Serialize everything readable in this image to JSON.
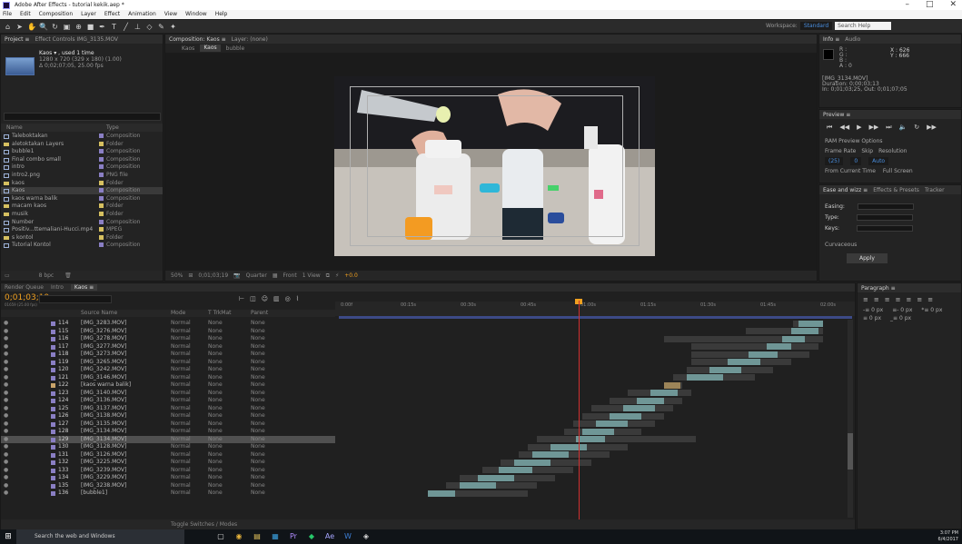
{
  "window": {
    "title": "Adobe After Effects - tutorial kekik.aep *",
    "controls": [
      "–",
      "□",
      "✕"
    ]
  },
  "menu": [
    "File",
    "Edit",
    "Composition",
    "Layer",
    "Effect",
    "Animation",
    "View",
    "Window",
    "Help"
  ],
  "workspace": {
    "label": "Workspace:",
    "value": "Standard",
    "search_placeholder": "Search Help"
  },
  "project": {
    "tabs": [
      "Project ≡",
      "Effect Controls IMG_3135.MOV"
    ],
    "selected_name": "Kaos ▾ , used 1 time",
    "selected_info_1": "1280 x 720 (329 x 180) (1.00)",
    "selected_info_2": "Δ 0;02;07;05, 25.00 fps",
    "search_placeholder": "",
    "col_name": "Name",
    "col_type": "Type",
    "items": [
      {
        "name": "Taleboktakan",
        "type": "Composition",
        "icon": "comp",
        "label": "#8a7fc4"
      },
      {
        "name": "aletoktakan Layers",
        "type": "Folder",
        "icon": "folder",
        "label": "#d6c060"
      },
      {
        "name": "bubble1",
        "type": "Composition",
        "icon": "comp",
        "label": "#8a7fc4"
      },
      {
        "name": "Final combo small",
        "type": "Composition",
        "icon": "comp",
        "label": "#8a7fc4"
      },
      {
        "name": "intro",
        "type": "Composition",
        "icon": "comp",
        "label": "#8a7fc4"
      },
      {
        "name": "intro2.png",
        "type": "PNG file",
        "icon": "image",
        "label": "#8a7fc4"
      },
      {
        "name": "kaos",
        "type": "Folder",
        "icon": "folder",
        "label": "#d6c060"
      },
      {
        "name": "Kaos",
        "type": "Composition",
        "icon": "comp",
        "label": "#8a7fc4",
        "selected": true
      },
      {
        "name": "kaos warna balik",
        "type": "Composition",
        "icon": "comp",
        "label": "#8a7fc4"
      },
      {
        "name": "macam kaos",
        "type": "Folder",
        "icon": "folder",
        "label": "#d6c060"
      },
      {
        "name": "musik",
        "type": "Folder",
        "icon": "folder",
        "label": "#d6c060"
      },
      {
        "name": "Number",
        "type": "Composition",
        "icon": "comp",
        "label": "#8a7fc4"
      },
      {
        "name": "Positiv...ttemaliani-Hucci.mp4",
        "type": "MPEG",
        "icon": "video",
        "label": "#d6c060"
      },
      {
        "name": "s kontol",
        "type": "Folder",
        "icon": "folder",
        "label": "#d6c060"
      },
      {
        "name": "Tutorial Kontol",
        "type": "Composition",
        "icon": "comp",
        "label": "#8a7fc4"
      }
    ],
    "footer": "8 bpc"
  },
  "comp_viewer": {
    "tab": "Composition: Kaos ≡",
    "tab2": "Layer: (none)",
    "flow_label": "Kaos",
    "crumb": "Kaos",
    "crumb2": "bubble",
    "zoom": "50%",
    "timecode": "0;01;03;19",
    "resolution": "Quarter",
    "camera": "Front",
    "views": "1 View",
    "plus": "+0.0"
  },
  "info_panel": {
    "tabs": [
      "Info ≡",
      "Audio"
    ],
    "rgb": [
      "R :",
      "G :",
      "B :",
      "A : 0"
    ],
    "x": "X : 626",
    "y": "Y : 666",
    "clip_name": "[IMG_3134.MOV]",
    "duration": "Duration: 0;00;03;13",
    "inout": "In: 0;01;03;25, Out: 0;01;07;05"
  },
  "preview_panel": {
    "title": "Preview ≡",
    "ram": "RAM Preview Options",
    "frame_rate": "Frame Rate",
    "skip": "Skip",
    "resolution": "Resolution",
    "fr_value": "(25)",
    "skip_value": "0",
    "res_value": "Auto",
    "from_current": "From Current Time",
    "full_screen": "Full Screen"
  },
  "tracker_panel": {
    "tabs": [
      "Ease and wizz ≡",
      "Effects & Presets",
      "Tracker"
    ],
    "easing_label": "Easing:",
    "type_label": "Type:",
    "keys_label": "Keys:",
    "curvaceous": "Curvaceous",
    "apply": "Apply"
  },
  "timeline": {
    "tabs": [
      "Render Queue",
      "Intro",
      "Kaos ≡"
    ],
    "timecode": "0;01;03;19",
    "fps": "01659 (25.00 fps)",
    "col_source": "Source Name",
    "col_mode": "Mode",
    "col_trk": "T TrkMat",
    "col_parent": "Parent",
    "footer_toggle": "Toggle Switches / Modes",
    "ruler": [
      "0:00f",
      "00:15s",
      "00:30s",
      "00:45s",
      "01:00s",
      "01:15s",
      "01:30s",
      "01:45s",
      "02:00s"
    ],
    "layers": [
      {
        "num": "114",
        "name": "[IMG_3283.MOV]",
        "mode": "Normal",
        "trk": "None",
        "parent": "None",
        "bar_start": 872,
        "bar_end": 905,
        "in_start": 878,
        "in_end": 905
      },
      {
        "num": "115",
        "name": "[IMG_3276.MOV]",
        "mode": "Normal",
        "trk": "None",
        "parent": "None",
        "bar_start": 820,
        "bar_end": 905,
        "in_start": 870,
        "in_end": 900
      },
      {
        "num": "116",
        "name": "[IMG_3278.MOV]",
        "mode": "Normal",
        "trk": "None",
        "parent": "None",
        "bar_start": 730,
        "bar_end": 905,
        "in_start": 860,
        "in_end": 885
      },
      {
        "num": "117",
        "name": "[IMG_3277.MOV]",
        "mode": "Normal",
        "trk": "None",
        "parent": "None",
        "bar_start": 760,
        "bar_end": 900,
        "in_start": 843,
        "in_end": 870
      },
      {
        "num": "118",
        "name": "[IMG_3273.MOV]",
        "mode": "Normal",
        "trk": "None",
        "parent": "None",
        "bar_start": 760,
        "bar_end": 890,
        "in_start": 823,
        "in_end": 855
      },
      {
        "num": "119",
        "name": "[IMG_3265.MOV]",
        "mode": "Normal",
        "trk": "None",
        "parent": "None",
        "bar_start": 760,
        "bar_end": 870,
        "in_start": 800,
        "in_end": 836
      },
      {
        "num": "120",
        "name": "[IMG_3242.MOV]",
        "mode": "Normal",
        "trk": "None",
        "parent": "None",
        "bar_start": 755,
        "bar_end": 850,
        "in_start": 780,
        "in_end": 815
      },
      {
        "num": "121",
        "name": "[IMG_3146.MOV]",
        "mode": "Normal",
        "trk": "None",
        "parent": "None",
        "bar_start": 740,
        "bar_end": 830,
        "in_start": 755,
        "in_end": 795
      },
      {
        "num": "122",
        "name": "[kaos warna balik]",
        "mode": "Normal",
        "trk": "None",
        "parent": "None",
        "bar_start": 730,
        "bar_end": 750,
        "in_start": 730,
        "in_end": 748,
        "tan": true
      },
      {
        "num": "123",
        "name": "[IMG_3140.MOV]",
        "mode": "Normal",
        "trk": "None",
        "parent": "None",
        "bar_start": 690,
        "bar_end": 760,
        "in_start": 715,
        "in_end": 745
      },
      {
        "num": "124",
        "name": "[IMG_3136.MOV]",
        "mode": "Normal",
        "trk": "None",
        "parent": "None",
        "bar_start": 670,
        "bar_end": 750,
        "in_start": 700,
        "in_end": 730
      },
      {
        "num": "125",
        "name": "[IMG_3137.MOV]",
        "mode": "Normal",
        "trk": "None",
        "parent": "None",
        "bar_start": 650,
        "bar_end": 740,
        "in_start": 685,
        "in_end": 720
      },
      {
        "num": "126",
        "name": "[IMG_3138.MOV]",
        "mode": "Normal",
        "trk": "None",
        "parent": "None",
        "bar_start": 640,
        "bar_end": 730,
        "in_start": 670,
        "in_end": 705
      },
      {
        "num": "127",
        "name": "[IMG_3135.MOV]",
        "mode": "Normal",
        "trk": "None",
        "parent": "None",
        "bar_start": 630,
        "bar_end": 720,
        "in_start": 655,
        "in_end": 690
      },
      {
        "num": "128",
        "name": "[IMG_3134.MOV]",
        "mode": "Normal",
        "trk": "None",
        "parent": "None",
        "bar_start": 620,
        "bar_end": 705,
        "in_start": 640,
        "in_end": 675
      },
      {
        "num": "129",
        "name": "[IMG_3134.MOV]",
        "mode": "Normal",
        "trk": "None",
        "parent": "None",
        "bar_start": 590,
        "bar_end": 765,
        "in_start": 633,
        "in_end": 665,
        "selected": true
      },
      {
        "num": "130",
        "name": "[IMG_3128.MOV]",
        "mode": "Normal",
        "trk": "None",
        "parent": "None",
        "bar_start": 580,
        "bar_end": 690,
        "in_start": 605,
        "in_end": 645
      },
      {
        "num": "131",
        "name": "[IMG_3126.MOV]",
        "mode": "Normal",
        "trk": "None",
        "parent": "None",
        "bar_start": 570,
        "bar_end": 670,
        "in_start": 585,
        "in_end": 625
      },
      {
        "num": "132",
        "name": "[IMG_3225.MOV]",
        "mode": "Normal",
        "trk": "None",
        "parent": "None",
        "bar_start": 550,
        "bar_end": 650,
        "in_start": 565,
        "in_end": 605
      },
      {
        "num": "133",
        "name": "[IMG_3239.MOV]",
        "mode": "Normal",
        "trk": "None",
        "parent": "None",
        "bar_start": 530,
        "bar_end": 630,
        "in_start": 548,
        "in_end": 585
      },
      {
        "num": "134",
        "name": "[IMG_3229.MOV]",
        "mode": "Normal",
        "trk": "None",
        "parent": "None",
        "bar_start": 505,
        "bar_end": 610,
        "in_start": 525,
        "in_end": 565
      },
      {
        "num": "135",
        "name": "[IMG_3238.MOV]",
        "mode": "Normal",
        "trk": "None",
        "parent": "None",
        "bar_start": 490,
        "bar_end": 590,
        "in_start": 505,
        "in_end": 545
      },
      {
        "num": "136",
        "name": "[bubble1]",
        "mode": "Normal",
        "trk": "None",
        "parent": "None",
        "bar_start": 470,
        "bar_end": 580,
        "in_start": 470,
        "in_end": 500
      }
    ]
  },
  "paragraph_panel": {
    "title": "Paragraph ≡",
    "f1": "-≡ 0 px",
    "f2": "≡- 0 px",
    "f3": "*≡ 0 px",
    "f4": "≡ 0 px",
    "f5": "_≡ 0 px"
  },
  "taskbar": {
    "search": "Search the web and Windows",
    "time": "3:07 PM",
    "date": "6/4/2017"
  }
}
